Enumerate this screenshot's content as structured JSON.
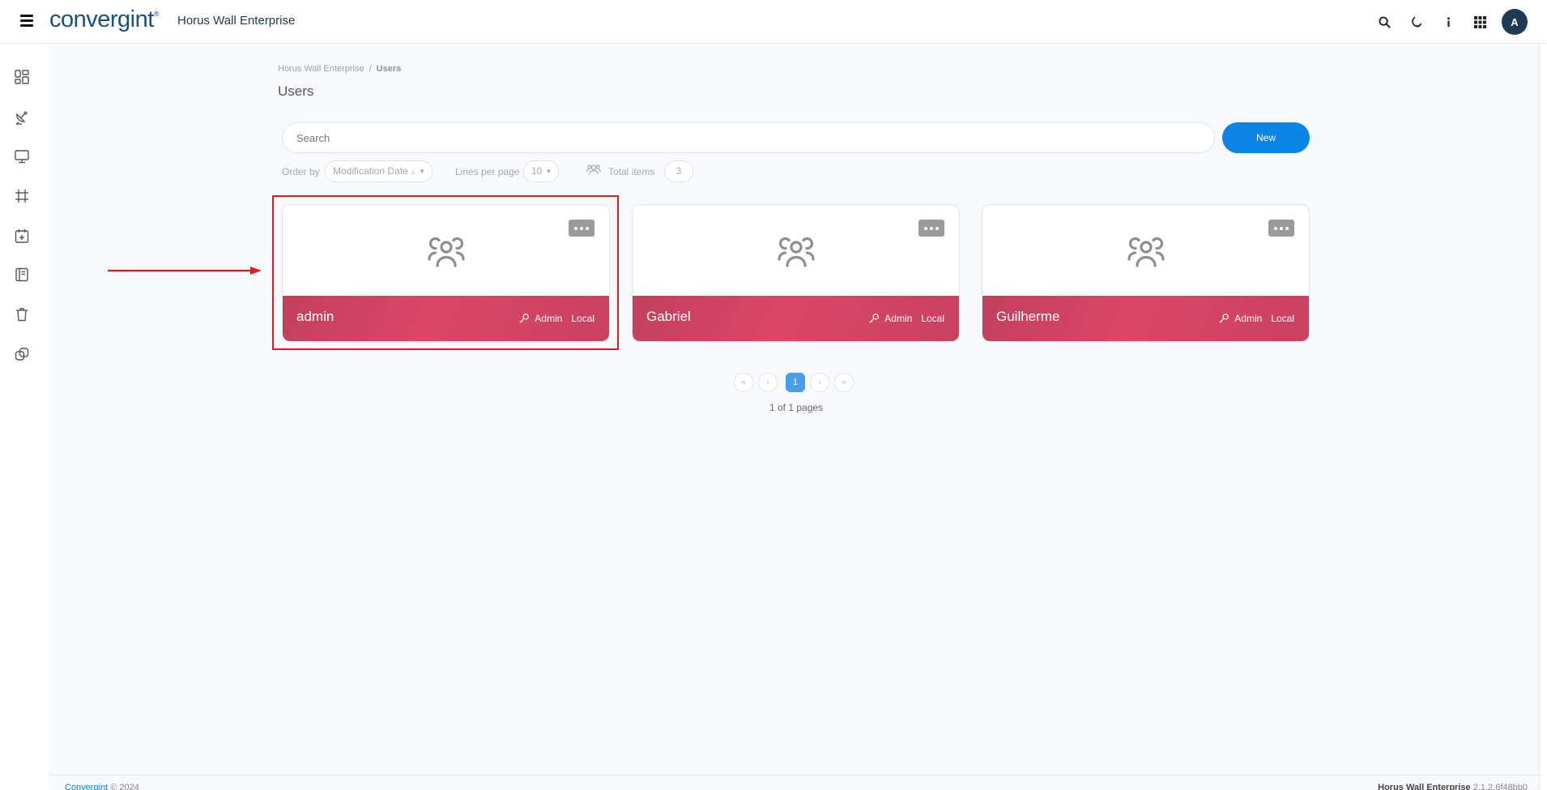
{
  "header": {
    "logo_text": "convergint",
    "logo_mark": "®",
    "app_title": "Horus Wall Enterprise",
    "avatar_initial": "A",
    "icons": [
      "menu-icon",
      "search-icon",
      "moon-icon",
      "info-icon",
      "apps-grid-icon"
    ]
  },
  "sidebar": {
    "items": [
      {
        "icon": "dashboard-icon"
      },
      {
        "icon": "satellite-dish-icon"
      },
      {
        "icon": "monitor-icon"
      },
      {
        "icon": "frame-icon"
      },
      {
        "icon": "calendar-add-icon"
      },
      {
        "icon": "notebook-icon"
      },
      {
        "icon": "trash-icon"
      },
      {
        "icon": "layers-link-icon"
      }
    ]
  },
  "breadcrumb": {
    "root": "Horus Wall Enterprise",
    "separator": "/",
    "current": "Users"
  },
  "page": {
    "title": "Users"
  },
  "search": {
    "placeholder": "Search",
    "value": ""
  },
  "toolbar": {
    "new_label": "New"
  },
  "filters": {
    "order_by_label": "Order by",
    "order_by_value": "Modification Date ↓",
    "lines_per_page_label": "Lines per page",
    "lines_per_page_value": "10",
    "total_items_label": "Total items",
    "total_items_value": "3"
  },
  "users": [
    {
      "name": "admin",
      "role": "Admin",
      "source": "Local",
      "highlighted": true
    },
    {
      "name": "Gabriel",
      "role": "Admin",
      "source": "Local",
      "highlighted": false
    },
    {
      "name": "Guilherme",
      "role": "Admin",
      "source": "Local",
      "highlighted": false
    }
  ],
  "pagination": {
    "first": "«",
    "prev": "‹",
    "current": "1",
    "next": "›",
    "last": "»",
    "summary": "1 of 1 pages"
  },
  "footer": {
    "brand": "Convergint",
    "copyright": "© 2024",
    "product": "Horus Wall Enterprise",
    "version": "2.1.2.6f48bb0"
  },
  "colors": {
    "primary": "#0a84e6",
    "card_footer": "#d6435f",
    "highlight": "#e8181b",
    "header_text": "#1c4f7a"
  }
}
